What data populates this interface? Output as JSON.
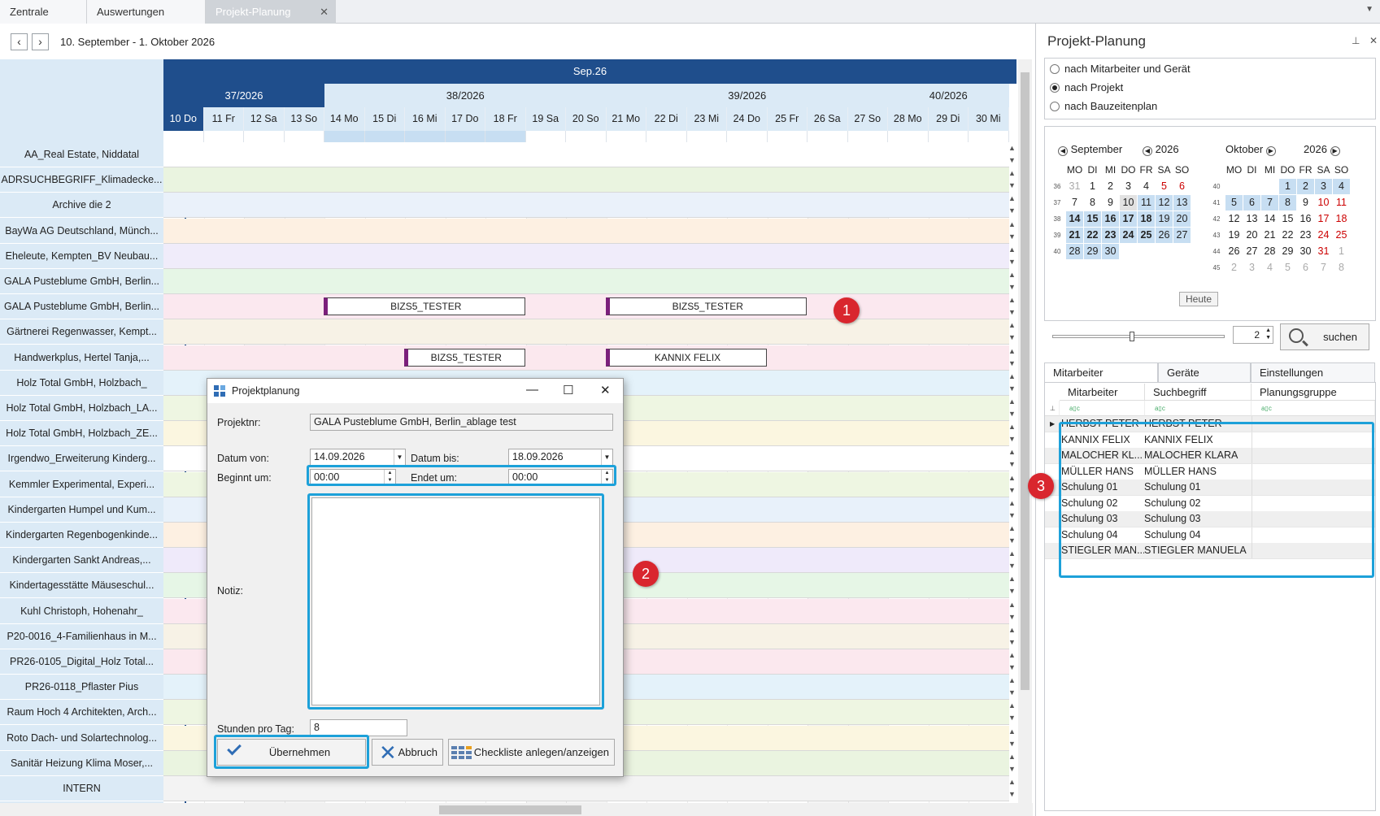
{
  "tabs": [
    {
      "label": "Zentrale"
    },
    {
      "label": "Auswertungen"
    },
    {
      "label": "Projekt-Planung",
      "close": "✕"
    }
  ],
  "nav": {
    "prev": "‹",
    "next": "›",
    "range": "10. September - 1. Oktober 2026"
  },
  "gantt": {
    "month": "Sep.26",
    "weeks": [
      "37/2026",
      "38/2026",
      "39/2026",
      "40/2026"
    ],
    "days": [
      "10 Do",
      "11 Fr",
      "12 Sa",
      "13 So",
      "14 Mo",
      "15 Di",
      "16 Mi",
      "17 Do",
      "18 Fr",
      "19 Sa",
      "20 So",
      "21 Mo",
      "22 Di",
      "23 Mi",
      "24 Do",
      "25 Fr",
      "26 Sa",
      "27 So",
      "28 Mo",
      "29 Di",
      "30 Mi"
    ],
    "rows": [
      "AA_Real Estate, Niddatal",
      "ADRSUCHBEGRIFF_Klimadecke...",
      "Archive die 2",
      "BayWa AG Deutschland, Münch...",
      "Eheleute, Kempten_BV Neubau...",
      "GALA Pusteblume GmbH, Berlin...",
      "GALA Pusteblume GmbH, Berlin...",
      "Gärtnerei Regenwasser, Kempt...",
      "Handwerkplus, Hertel Tanja,...",
      "Holz Total GmbH, Holzbach_",
      "Holz Total GmbH, Holzbach_LA...",
      "Holz Total GmbH, Holzbach_ZE...",
      "Irgendwo_Erweiterung Kinderg...",
      "Kemmler Experimental, Experi...",
      "Kindergarten Humpel und Kum...",
      "Kindergarten Regenbogenkinde...",
      "Kindergarten Sankt Andreas,...",
      "Kindertagesstätte Mäuseschul...",
      "Kuhl Christoph, Hohenahr_",
      "P20-0016_4-Familienhaus in M...",
      "PR26-0105_Digital_Holz Total...",
      "PR26-0118_Pflaster Pius",
      "Raum Hoch 4 Architekten, Arch...",
      "Roto Dach- und Solartechnolog...",
      "Sanitär Heizung Klima Moser,...",
      "INTERN"
    ],
    "rowColors": [
      "#ffffff",
      "#eaf4e0",
      "#eaf1fa",
      "#fdf0e2",
      "#f0ecfa",
      "#e6f6e6",
      "#fbe8ef",
      "#f7f2e6",
      "#fbe8ee",
      "#e4f2fa",
      "#eef6e2",
      "#fbf6e0",
      "#ffffff",
      "#eef6e2",
      "#e8f1fa",
      "#fdf0e2",
      "#efeafa",
      "#e6f6e6",
      "#fbe8ef",
      "#f7f2e6",
      "#fbe8ee",
      "#e4f2fa",
      "#eef6e2",
      "#fbf6e0",
      "#eaf4e0",
      "#f3f3f3"
    ],
    "bars": [
      "BIZS5_TESTER",
      "BIZS5_TESTER",
      "BIZS5_TESTER",
      "KANNIX FELIX"
    ]
  },
  "panel": {
    "title": "Projekt-Planung",
    "pin": "📌",
    "close": "✕",
    "radios": [
      "nach Mitarbeiter und Gerät",
      "nach Projekt",
      "nach Bauzeitenplan"
    ],
    "cal1": {
      "month": "September",
      "year": "2026"
    },
    "cal2": {
      "month": "Oktober",
      "year": "2026"
    },
    "dow": [
      "MO",
      "DI",
      "MI",
      "DO",
      "FR",
      "SA",
      "SO"
    ],
    "today": "Heute",
    "spin": "2",
    "search": "suchen",
    "tabs": [
      "Mitarbeiter",
      "Geräte",
      "Einstellungen"
    ],
    "cols": [
      "Mitarbeiter",
      "Suchbegriff",
      "Planungsgruppe"
    ],
    "filter": "a▯c",
    "rows": [
      [
        "HERBST PETER",
        "HERBST PETER"
      ],
      [
        "KANNIX FELIX",
        "KANNIX FELIX"
      ],
      [
        "MALOCHER KL...",
        "MALOCHER KLARA"
      ],
      [
        "MÜLLER HANS",
        "MÜLLER HANS"
      ],
      [
        "Schulung 01",
        "Schulung 01"
      ],
      [
        "Schulung 02",
        "Schulung 02"
      ],
      [
        "Schulung 03",
        "Schulung 03"
      ],
      [
        "Schulung 04",
        "Schulung 04"
      ],
      [
        "STIEGLER MAN...",
        "STIEGLER MANUELA"
      ]
    ]
  },
  "dialog": {
    "title": "Projektplanung",
    "min": "—",
    "max": "☐",
    "close": "✕",
    "projektnr_label": "Projektnr:",
    "projektnr": "GALA Pusteblume GmbH, Berlin_ablage test",
    "von_label": "Datum von:",
    "von": "14.09.2026",
    "bis_label": "Datum bis:",
    "bis": "18.09.2026",
    "beginn_label": "Beginnt um:",
    "beginn": "00:00",
    "ende_label": "Endet um:",
    "ende": "00:00",
    "notiz_label": "Notiz:",
    "stunden_label": "Stunden pro Tag:",
    "stunden": "8",
    "ok": "Übernehmen",
    "abbruch": "Abbruch",
    "checkliste": "Checkliste anlegen/anzeigen"
  },
  "badges": [
    "1",
    "2",
    "3"
  ]
}
